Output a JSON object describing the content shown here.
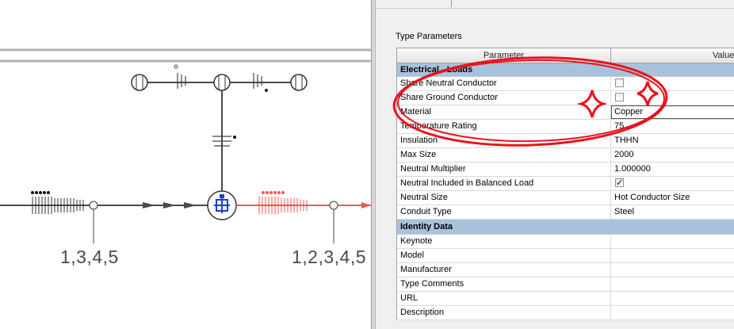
{
  "diagram": {
    "labels": [
      "1,3,4,5",
      "1,2,3,4,5"
    ]
  },
  "type_parameters": {
    "section_title": "Type Parameters",
    "columns": {
      "parameter": "Parameter",
      "value": "Value"
    },
    "groups": [
      {
        "title": "Electrical - Loads",
        "rows": [
          {
            "name": "Share Neutral Conductor",
            "kind": "checkbox",
            "checked": false
          },
          {
            "name": "Share Ground Conductor",
            "kind": "checkbox",
            "checked": false
          },
          {
            "name": "Material",
            "kind": "text",
            "value": "Copper"
          },
          {
            "name": "Temperature Rating",
            "kind": "text",
            "value": "75"
          },
          {
            "name": "Insulation",
            "kind": "text",
            "value": "THHN"
          },
          {
            "name": "Max Size",
            "kind": "text",
            "value": "2000"
          },
          {
            "name": "Neutral Multiplier",
            "kind": "text",
            "value": "1.000000"
          },
          {
            "name": "Neutral Included in Balanced Load",
            "kind": "checkbox",
            "checked": true
          },
          {
            "name": "Neutral Size",
            "kind": "text",
            "value": "Hot Conductor Size"
          },
          {
            "name": "Conduit Type",
            "kind": "text",
            "value": "Steel"
          }
        ]
      },
      {
        "title": "Identity Data",
        "rows": [
          {
            "name": "Keynote",
            "kind": "text",
            "value": ""
          },
          {
            "name": "Model",
            "kind": "text",
            "value": ""
          },
          {
            "name": "Manufacturer",
            "kind": "text",
            "value": ""
          },
          {
            "name": "Type Comments",
            "kind": "text",
            "value": ""
          },
          {
            "name": "URL",
            "kind": "text",
            "value": ""
          },
          {
            "name": "Description",
            "kind": "text",
            "value": ""
          }
        ]
      }
    ]
  },
  "annotation_color": "#e8141e"
}
